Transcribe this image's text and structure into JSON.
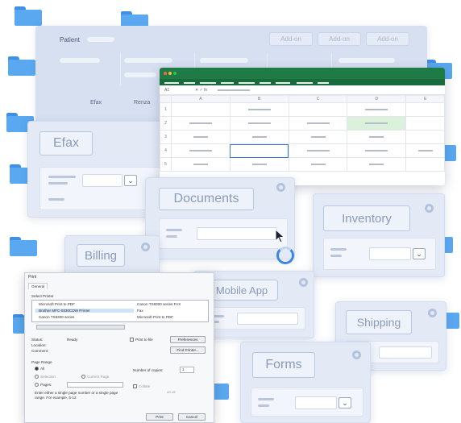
{
  "background_window": {
    "title": "Patient",
    "addon_buttons": [
      "Add-on",
      "Add-on",
      "Add-on"
    ],
    "tabs": [
      "Efax",
      "Renza"
    ]
  },
  "spreadsheet": {
    "cell_ref": "A1",
    "columns": [
      "A",
      "B",
      "C",
      "D",
      "E"
    ],
    "row_numbers": [
      "1",
      "2",
      "3",
      "4",
      "5"
    ]
  },
  "cards": {
    "efax": "Efax",
    "documents": "Documents",
    "inventory": "Inventory",
    "billing": "Billing",
    "mobile_app": "Mobile App",
    "shipping": "Shipping",
    "forms": "Forms"
  },
  "print_dialog": {
    "title": "Print",
    "tab": "General",
    "select_printer": "Select Printer",
    "printers": [
      "Microsoft Print to PDF",
      "Brother MFC-9330CDW Printer",
      "Canon TS8300 series"
    ],
    "printers_right": [
      "Canon TS8300 series FAX",
      "Fax",
      "Microsoft Print to PDF"
    ],
    "status_label": "Status:",
    "status_value": "Ready",
    "location_label": "Location:",
    "comment_label": "Comment:",
    "print_to_file": "Print to file",
    "preferences": "Preferences",
    "find_printer": "Find Printer...",
    "page_range": "Page Range",
    "all": "All",
    "selection": "Selection",
    "current_page": "Current Page",
    "pages": "Pages:",
    "pages_hint": "Enter either a single page number or a single page range. For example, 5-12",
    "copies_label": "Number of copies:",
    "copies_value": "1",
    "collate": "Collate",
    "print_button": "Print",
    "cancel_button": "Cancel"
  },
  "colors": {
    "accent_blue": "#3a86e0",
    "folder_blue": "#5aa8f0",
    "excel_green": "#1f7b45",
    "card_bg": "#e3eaf6"
  }
}
